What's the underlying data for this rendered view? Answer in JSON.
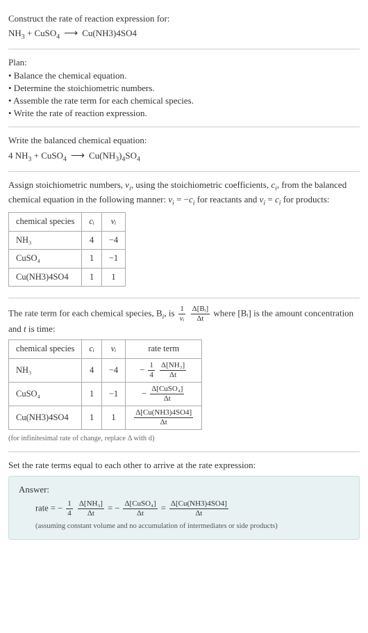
{
  "header": {
    "prompt": "Construct the rate of reaction expression for:",
    "reaction_unbalanced_lhs_1": "NH",
    "reaction_unbalanced_lhs_1_sub": "3",
    "plus": " + ",
    "reaction_unbalanced_lhs_2": "CuSO",
    "reaction_unbalanced_lhs_2_sub": "4",
    "arrow": "⟶",
    "reaction_unbalanced_rhs": "Cu(NH3)4SO4"
  },
  "plan": {
    "title": "Plan:",
    "b1": "• Balance the chemical equation.",
    "b2": "• Determine the stoichiometric numbers.",
    "b3": "• Assemble the rate term for each chemical species.",
    "b4": "• Write the rate of reaction expression."
  },
  "balanced": {
    "intro": "Write the balanced chemical equation:",
    "coef1": "4 ",
    "sp1": "NH",
    "sp1_sub": "3",
    "plus": " + ",
    "sp2": "CuSO",
    "sp2_sub": "4",
    "arrow": "⟶",
    "sp3": "Cu(NH",
    "sp3_sub1": "3",
    "sp3_mid": ")",
    "sp3_sub2": "4",
    "sp3_end": "SO",
    "sp3_sub3": "4"
  },
  "stoich": {
    "intro_a": "Assign stoichiometric numbers, ",
    "nu_i": "ν",
    "sub_i": "i",
    "intro_b": ", using the stoichiometric coefficients, ",
    "c_i": "c",
    "intro_c": ", from the balanced chemical equation in the following manner: ",
    "rule_react": " = −",
    "intro_d": " for reactants and ",
    "rule_prod": " = ",
    "intro_e": " for products:",
    "hdr_species": "chemical species",
    "hdr_c": "cᵢ",
    "hdr_nu": "νᵢ",
    "rows": [
      {
        "species": "NH₃",
        "c": "4",
        "nu": "−4"
      },
      {
        "species": "CuSO₄",
        "c": "1",
        "nu": "−1"
      },
      {
        "species": "Cu(NH3)4SO4",
        "c": "1",
        "nu": "1"
      }
    ]
  },
  "rate_terms": {
    "intro_a": "The rate term for each chemical species, B",
    "sub_i": "i",
    "intro_b": ", is ",
    "one": "1",
    "nu_i": "νᵢ",
    "delta_Bi": "Δ[Bᵢ]",
    "delta_t": "Δt",
    "intro_c": " where [Bᵢ] is the amount concentration and ",
    "t_word": "t",
    "intro_d": " is time:",
    "hdr_species": "chemical species",
    "hdr_c": "cᵢ",
    "hdr_nu": "νᵢ",
    "hdr_rate": "rate term",
    "rows": [
      {
        "species": "NH₃",
        "c": "4",
        "nu": "−4",
        "neg": "−",
        "factor_num": "1",
        "factor_den": "4",
        "d_num": "Δ[NH₃]",
        "d_den": "Δt"
      },
      {
        "species": "CuSO₄",
        "c": "1",
        "nu": "−1",
        "neg": "−",
        "factor_num": "",
        "factor_den": "",
        "d_num": "Δ[CuSO₄]",
        "d_den": "Δt"
      },
      {
        "species": "Cu(NH3)4SO4",
        "c": "1",
        "nu": "1",
        "neg": "",
        "factor_num": "",
        "factor_den": "",
        "d_num": "Δ[Cu(NH3)4SO4]",
        "d_den": "Δt"
      }
    ],
    "note": "(for infinitesimal rate of change, replace Δ with d)"
  },
  "final": {
    "intro": "Set the rate terms equal to each other to arrive at the rate expression:",
    "answer_label": "Answer:",
    "rate_eq": "rate = ",
    "neg": "−",
    "one": "1",
    "four": "4",
    "t1_num": "Δ[NH₃]",
    "t1_den": "Δt",
    "eq": " = ",
    "t2_num": "Δ[CuSO₄]",
    "t2_den": "Δt",
    "t3_num": "Δ[Cu(NH3)4SO4]",
    "t3_den": "Δt",
    "note": "(assuming constant volume and no accumulation of intermediates or side products)"
  }
}
